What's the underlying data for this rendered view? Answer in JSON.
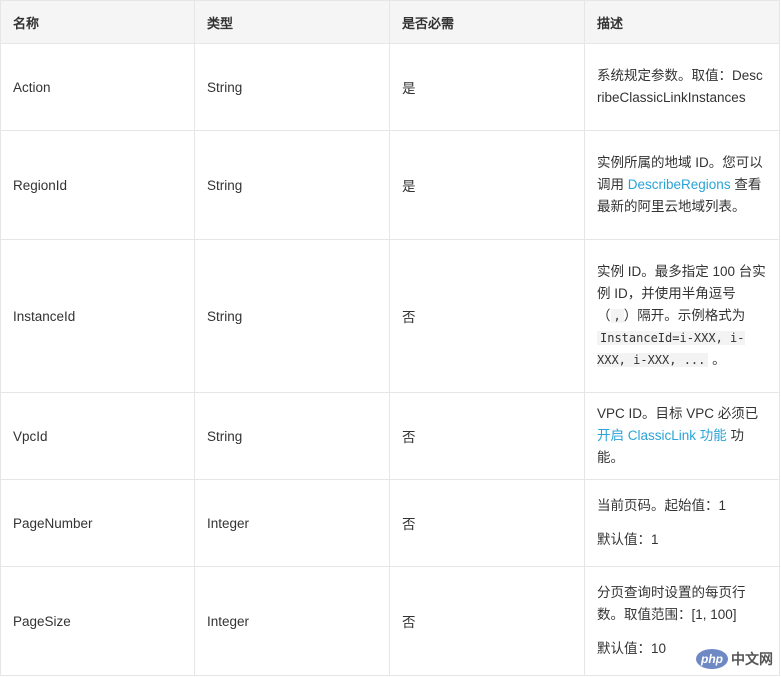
{
  "headers": {
    "name": "名称",
    "type": "类型",
    "required": "是否必需",
    "description": "描述"
  },
  "rows": [
    {
      "name": "Action",
      "type": "String",
      "required": "是",
      "desc": {
        "text": "系统规定参数。取值：DescribeClassicLinkInstances"
      }
    },
    {
      "name": "RegionId",
      "type": "String",
      "required": "是",
      "desc": {
        "pre": "实例所属的地域 ID。您可以调用 ",
        "link": "DescribeRegions",
        "post": " 查看最新的阿里云地域列表。"
      }
    },
    {
      "name": "InstanceId",
      "type": "String",
      "required": "否",
      "desc": {
        "t1": "实例 ID。最多指定 100 台实例 ID，并使用半角逗号（",
        "c1": ",",
        "t2": "）隔开。示例格式为 ",
        "c2": "InstanceId=i-XXX, i-XXX, i-XXX, ...",
        "t3": " 。"
      }
    },
    {
      "name": "VpcId",
      "type": "String",
      "required": "否",
      "desc": {
        "pre": "VPC ID。目标 VPC 必须已",
        "link": "开启 ClassicLink 功能",
        "post": " 功能。"
      }
    },
    {
      "name": "PageNumber",
      "type": "Integer",
      "required": "否",
      "desc": {
        "p1": "当前页码。起始值：1",
        "p2": "默认值：1"
      }
    },
    {
      "name": "PageSize",
      "type": "Integer",
      "required": "否",
      "desc": {
        "p1": "分页查询时设置的每页行数。取值范围：[1, 100]",
        "p2": "默认值：10"
      }
    }
  ],
  "watermark": {
    "logo": "php",
    "text": "中文网"
  }
}
